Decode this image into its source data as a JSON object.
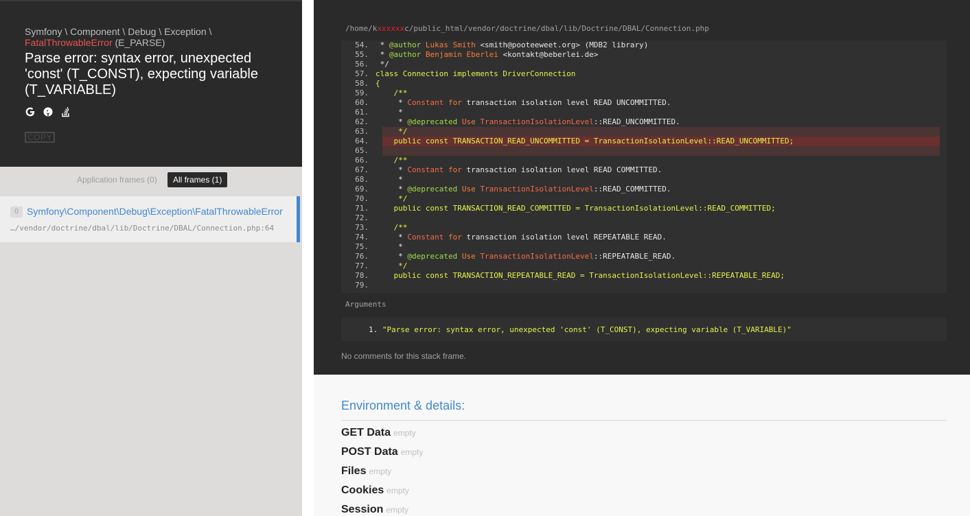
{
  "exception": {
    "namespace": [
      "Symfony",
      "Component",
      "Debug",
      "Exception"
    ],
    "separator": " \\ ",
    "class": "FatalThrowableError",
    "code": "(E_PARSE)",
    "message": "Parse error: syntax error, unexpected 'const' (T_CONST), expecting variable (T_VARIABLE)",
    "copy_label": "COPY"
  },
  "frames_filter": {
    "application": "Application frames (0)",
    "all": "All frames (1)"
  },
  "frame": {
    "index": "0",
    "class": "Symfony\\Component\\Debug\\Exception\\FatalThrowableError",
    "file": "…/vendor/doctrine/dbal/lib/Doctrine/DBAL/Connection.php:64"
  },
  "file": {
    "prefix": "/home/k",
    "redacted": "xxxxxx",
    "suffix": "c/public_html/vendor/doctrine/dbal/lib/Doctrine/DBAL/Connection.php"
  },
  "code_lines": [
    {
      "n": "54.",
      "html": " * <span class=\"ann\">@author</span> <span class=\"tag\">Lukas Smith</span> &lt;smith@pooteeweet.org&gt; (MDB2 library)"
    },
    {
      "n": "55.",
      "html": " * <span class=\"ann\">@author</span> <span class=\"tag\">Benjamin Eberlei</span> &lt;kontakt@beberlei.de&gt;"
    },
    {
      "n": "56.",
      "html": " */"
    },
    {
      "n": "57.",
      "html": "<span class=\"kw\">class Connection implements DriverConnection</span>"
    },
    {
      "n": "58.",
      "html": "<span class=\"kw\">{</span>"
    },
    {
      "n": "59.",
      "html": "    <span class=\"kw\">/**</span>"
    },
    {
      "n": "60.",
      "html": "     * <span class=\"nm\">Constant</span> <span class=\"tag\">for</span> transaction isolation level READ UNCOMMITTED."
    },
    {
      "n": "61.",
      "html": "     *"
    },
    {
      "n": "62.",
      "html": "     * <span class=\"ann\">@deprecated</span> <span class=\"tag\">Use</span> <span class=\"nm\">TransactionIsolationLevel</span>::READ_UNCOMMITTED."
    },
    {
      "n": "63.",
      "html": "     <span class=\"kw\">*/</span>"
    },
    {
      "n": "64.",
      "html": "    <span class=\"kw\">public const TRANSACTION_READ_UNCOMMITTED = TransactionIsolationLevel::READ_UNCOMMITTED;</span>"
    },
    {
      "n": "65.",
      "html": ""
    },
    {
      "n": "66.",
      "html": "    <span class=\"kw\">/**</span>"
    },
    {
      "n": "67.",
      "html": "     * <span class=\"nm\">Constant</span> <span class=\"tag\">for</span> transaction isolation level READ COMMITTED."
    },
    {
      "n": "68.",
      "html": "     *"
    },
    {
      "n": "69.",
      "html": "     * <span class=\"ann\">@deprecated</span> <span class=\"tag\">Use</span> <span class=\"nm\">TransactionIsolationLevel</span>::READ_COMMITTED."
    },
    {
      "n": "70.",
      "html": "     <span class=\"kw\">*/</span>"
    },
    {
      "n": "71.",
      "html": "    <span class=\"kw\">public const TRANSACTION_READ_COMMITTED = TransactionIsolationLevel::READ_COMMITTED;</span>"
    },
    {
      "n": "72.",
      "html": ""
    },
    {
      "n": "73.",
      "html": "    <span class=\"kw\">/**</span>"
    },
    {
      "n": "74.",
      "html": "     * <span class=\"nm\">Constant</span> <span class=\"tag\">for</span> transaction isolation level REPEATABLE READ."
    },
    {
      "n": "75.",
      "html": "     *"
    },
    {
      "n": "76.",
      "html": "     * <span class=\"ann\">@deprecated</span> <span class=\"tag\">Use</span> <span class=\"nm\">TransactionIsolationLevel</span>::REPEATABLE_READ."
    },
    {
      "n": "77.",
      "html": "     <span class=\"kw\">*/</span>"
    },
    {
      "n": "78.",
      "html": "    <span class=\"kw\">public const TRANSACTION_REPEATABLE_READ = TransactionIsolationLevel::REPEATABLE_READ;</span>"
    },
    {
      "n": "79.",
      "html": ""
    }
  ],
  "arguments": {
    "title": "Arguments",
    "index": "1.",
    "value": "\"Parse error: syntax error, unexpected 'const' (T_CONST), expecting variable (T_VARIABLE)\""
  },
  "no_comments": "No comments for this stack frame.",
  "environment": {
    "title": "Environment & details:",
    "empty_label": "empty",
    "sections": [
      "GET Data",
      "POST Data",
      "Files",
      "Cookies",
      "Session"
    ]
  },
  "icons": {
    "google": "google-icon",
    "duckduckgo": "duckduckgo-icon",
    "stackoverflow": "stackoverflow-icon"
  },
  "colors": {
    "accent": "#4288ce",
    "error": "#e95353",
    "highlight": "#6a2f2f"
  }
}
